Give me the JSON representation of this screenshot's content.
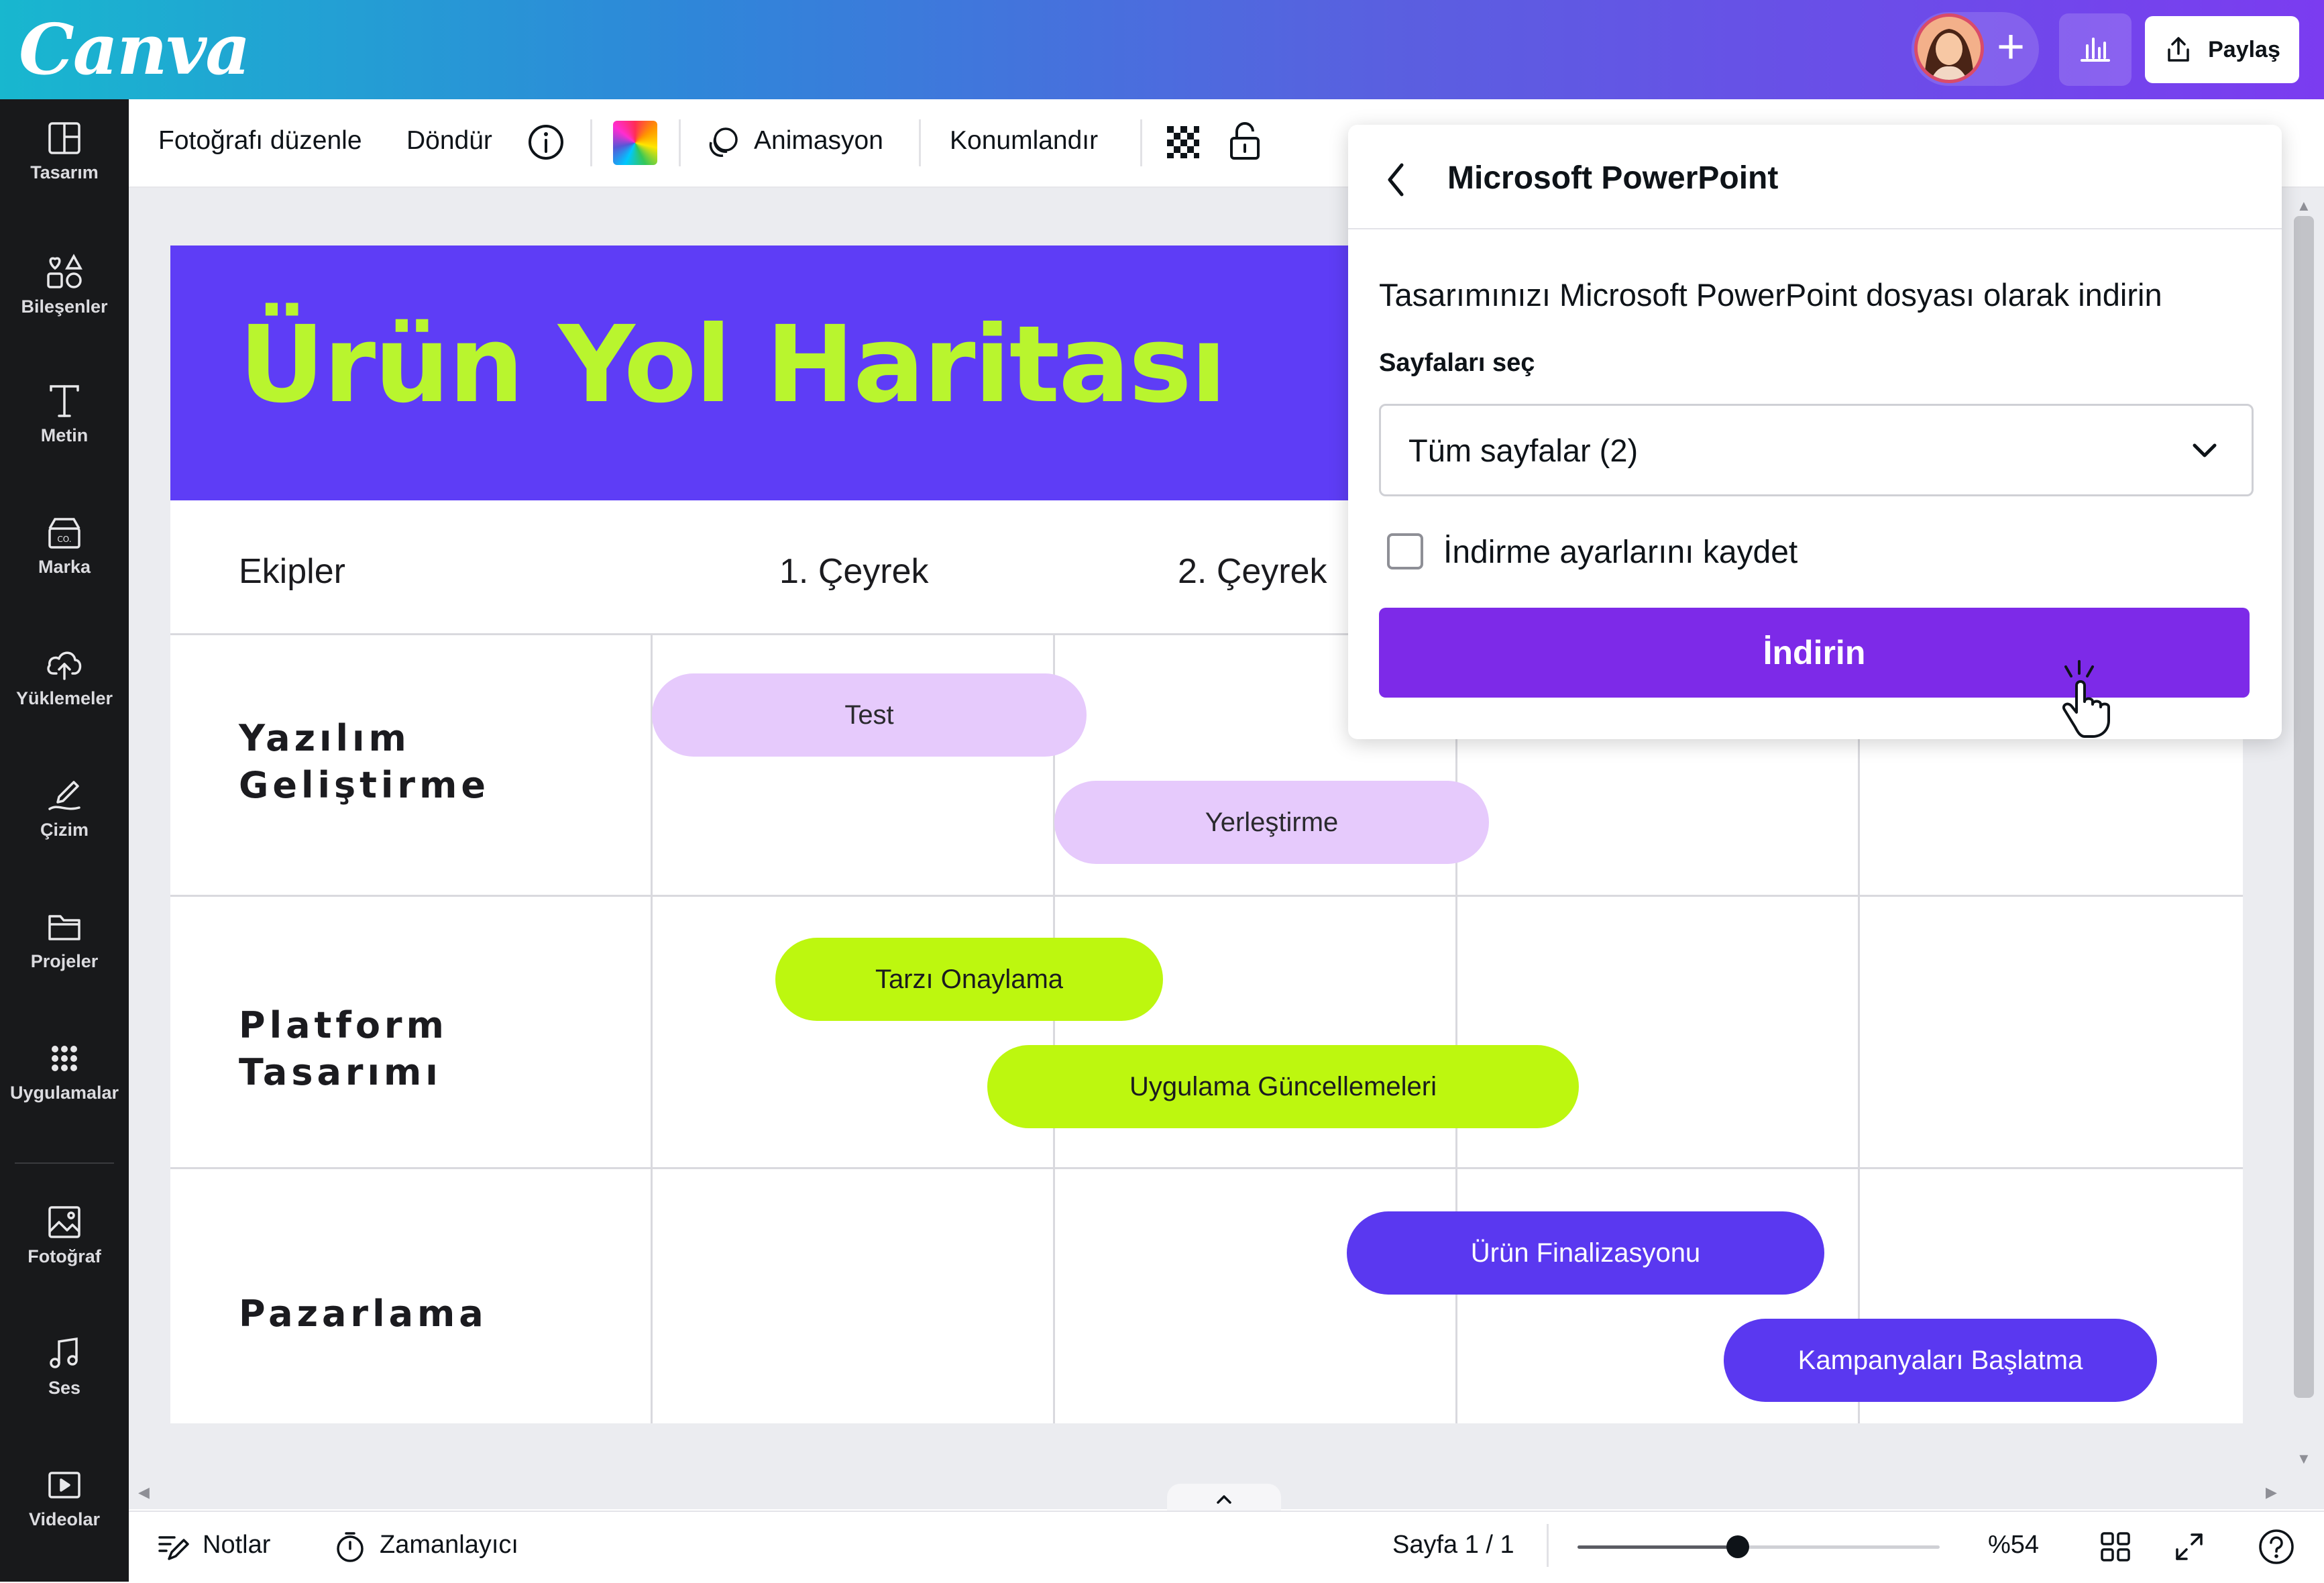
{
  "app": {
    "logo": "Canva",
    "share_label": "Paylaş",
    "brand_color": "#7d2ae8"
  },
  "sidebar": {
    "items": [
      {
        "label": "Tasarım",
        "icon": "layout-icon"
      },
      {
        "label": "Bileşenler",
        "icon": "shapes-icon"
      },
      {
        "label": "Metin",
        "icon": "text-icon"
      },
      {
        "label": "Marka",
        "icon": "brand-icon"
      },
      {
        "label": "Yüklemeler",
        "icon": "upload-cloud-icon"
      },
      {
        "label": "Çizim",
        "icon": "pen-icon"
      },
      {
        "label": "Projeler",
        "icon": "folder-icon"
      },
      {
        "label": "Uygulamalar",
        "icon": "apps-grid-icon"
      },
      {
        "label": "Fotoğraf",
        "icon": "photo-icon"
      },
      {
        "label": "Ses",
        "icon": "music-icon"
      },
      {
        "label": "Videolar",
        "icon": "video-icon"
      }
    ]
  },
  "toolbar": {
    "edit_photo": "Fotoğrafı düzenle",
    "rotate": "Döndür",
    "animate": "Animasyon",
    "position": "Konumlandır"
  },
  "design": {
    "title": "Ürün Yol Haritası",
    "columns": [
      "Ekipler",
      "1. Çeyrek",
      "2. Çeyrek"
    ],
    "teams": [
      {
        "name_line1": "Yazılım",
        "name_line2": "Geliştirme"
      },
      {
        "name_line1": "Platform",
        "name_line2": "Tasarımı"
      },
      {
        "name_line1": "Pazarlama",
        "name_line2": ""
      }
    ],
    "tasks": [
      {
        "label": "Test",
        "color": "#e6cafc"
      },
      {
        "label": "Yerleştirme",
        "color": "#e6cafc"
      },
      {
        "label": "Tarzı Onaylama",
        "color": "#bdf70f"
      },
      {
        "label": "Uygulama Güncellemeleri",
        "color": "#bdf70f"
      },
      {
        "label": "Ürün Finalizasyonu",
        "color": "#5a38f0"
      },
      {
        "label": "Kampanyaları Başlatma",
        "color": "#5a38f0"
      }
    ]
  },
  "panel": {
    "title": "Microsoft PowerPoint",
    "description": "Tasarımınızı Microsoft PowerPoint dosyası olarak indirin",
    "select_pages_label": "Sayfaları seç",
    "select_pages_value": "Tüm sayfalar (2)",
    "save_settings_label": "İndirme ayarlarını kaydet",
    "save_settings_checked": false,
    "download_label": "İndirin"
  },
  "bottombar": {
    "notes": "Notlar",
    "timer": "Zamanlayıcı",
    "page_indicator": "Sayfa 1 / 1",
    "zoom_label": "%54",
    "zoom_fraction": 0.54
  }
}
